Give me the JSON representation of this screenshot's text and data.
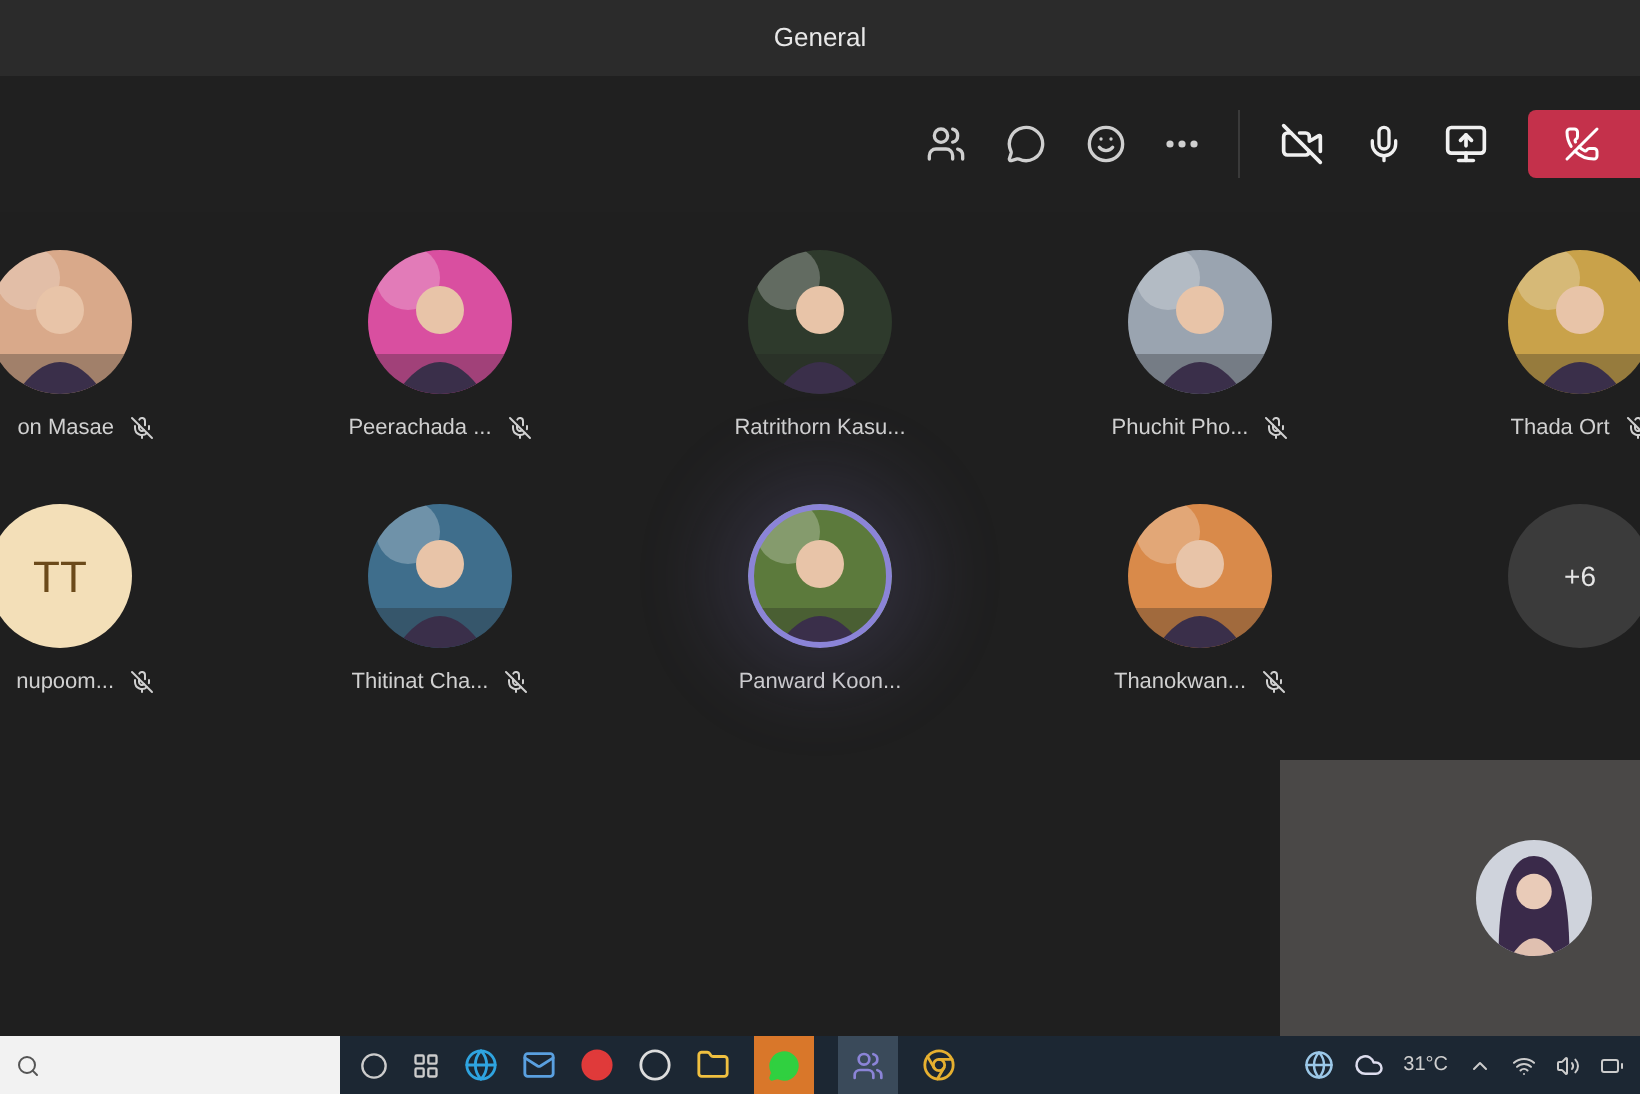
{
  "window": {
    "title": "General"
  },
  "participants": [
    {
      "name": "on Masae",
      "muted": true,
      "speaking": false,
      "color": "#d9a98a"
    },
    {
      "name": "Peerachada ...",
      "muted": true,
      "speaking": false,
      "color": "#d94fa0"
    },
    {
      "name": "Ratrithorn Kasu...",
      "muted": false,
      "speaking": false,
      "color": "#2e3a2c"
    },
    {
      "name": "Phuchit Pho...",
      "muted": true,
      "speaking": false,
      "color": "#9aa4b0"
    },
    {
      "name": "Thada Ort",
      "muted": true,
      "speaking": false,
      "color": "#c9a24a"
    },
    {
      "kind": "initials",
      "initials": "TT",
      "name": "nupoom...",
      "muted": true,
      "speaking": false
    },
    {
      "name": "Thitinat Cha...",
      "muted": true,
      "speaking": false,
      "color": "#3f6e8c"
    },
    {
      "name": "Panward Koon...",
      "muted": false,
      "speaking": true,
      "color": "#5c7a3c"
    },
    {
      "name": "Thanokwan...",
      "muted": true,
      "speaking": false,
      "color": "#d98a4a"
    },
    {
      "kind": "overflow",
      "label": "+6"
    }
  ],
  "taskbar": {
    "weather": "31°C"
  }
}
